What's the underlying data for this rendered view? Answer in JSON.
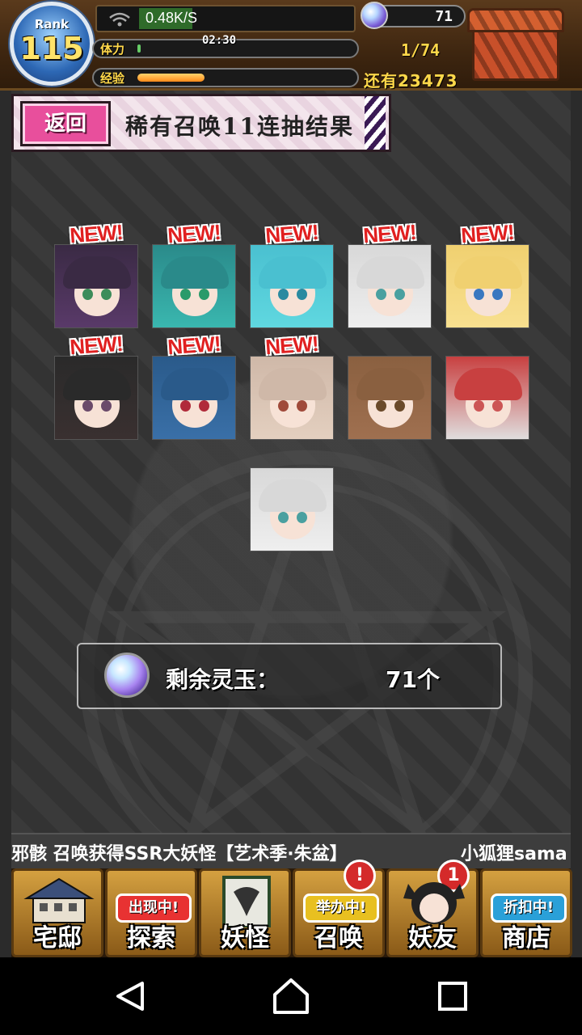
{
  "status": {
    "rank_label": "Rank",
    "rank_value": "115",
    "network_speed": "0.48K/S",
    "stamina_label": "体力",
    "stamina_timer": "02:30",
    "stamina_count": "1/74",
    "exp_label": "经验",
    "exp_progress": 0.32,
    "exp_remaining": "还有23473",
    "gem_count": "71"
  },
  "header": {
    "back_label": "返回",
    "title": "稀有召唤11连抽结果"
  },
  "results": [
    {
      "name": "result-card-1",
      "is_new": true,
      "new_label": "NEW!"
    },
    {
      "name": "result-card-2",
      "is_new": true,
      "new_label": "NEW!"
    },
    {
      "name": "result-card-3",
      "is_new": true,
      "new_label": "NEW!"
    },
    {
      "name": "result-card-4",
      "is_new": true,
      "new_label": "NEW!"
    },
    {
      "name": "result-card-5",
      "is_new": true,
      "new_label": "NEW!"
    },
    {
      "name": "result-card-6",
      "is_new": true,
      "new_label": "NEW!"
    },
    {
      "name": "result-card-7",
      "is_new": true,
      "new_label": "NEW!"
    },
    {
      "name": "result-card-8",
      "is_new": true,
      "new_label": "NEW!"
    },
    {
      "name": "result-card-9",
      "is_new": false
    },
    {
      "name": "result-card-10",
      "is_new": false
    },
    {
      "name": "result-card-11",
      "is_new": false
    }
  ],
  "remaining": {
    "label": "剩余灵玉：",
    "value": "71个"
  },
  "ticker": {
    "text": "邪骸 召唤获得SSR大妖怪【艺术季·朱盆】",
    "user": "小狐狸sama"
  },
  "nav": {
    "items": [
      {
        "label": "宅邸",
        "tag": ""
      },
      {
        "label": "探索",
        "tag": "出现中!"
      },
      {
        "label": "妖怪",
        "tag": ""
      },
      {
        "label": "召唤",
        "tag": "举办中!",
        "badge": "!"
      },
      {
        "label": "妖友",
        "tag": "",
        "badge": "1"
      },
      {
        "label": "商店",
        "tag": "折扣中!"
      }
    ]
  },
  "colors": {
    "accent_pink": "#e84f9c",
    "gold_text": "#ffd84a",
    "new_red": "#e02020"
  }
}
